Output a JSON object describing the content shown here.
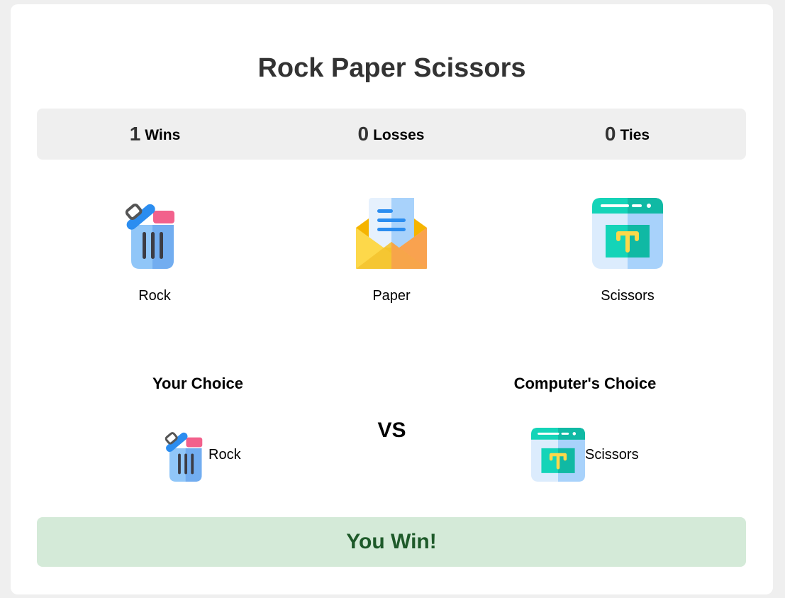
{
  "title": "Rock Paper Scissors",
  "scoreboard": {
    "wins": {
      "value": "1",
      "label": "Wins"
    },
    "losses": {
      "value": "0",
      "label": "Losses"
    },
    "ties": {
      "value": "0",
      "label": "Ties"
    }
  },
  "choices": [
    {
      "label": "Rock",
      "icon": "trash-bin-icon"
    },
    {
      "label": "Paper",
      "icon": "envelope-letter-icon"
    },
    {
      "label": "Scissors",
      "icon": "browser-window-icon"
    }
  ],
  "battle": {
    "your_heading": "Your Choice",
    "computer_heading": "Computer's Choice",
    "vs": "VS",
    "your_choice": {
      "label": "Rock",
      "icon": "trash-bin-icon"
    },
    "computer_choice": {
      "label": "Scissors",
      "icon": "browser-window-icon"
    }
  },
  "result": {
    "text": "You Win!"
  },
  "colors": {
    "page_bg": "#efefef",
    "card_bg": "#ffffff",
    "scoreboard_bg": "#efefef",
    "result_bg": "#d4ead8",
    "result_text": "#1e5a2a",
    "title_text": "#333333"
  }
}
